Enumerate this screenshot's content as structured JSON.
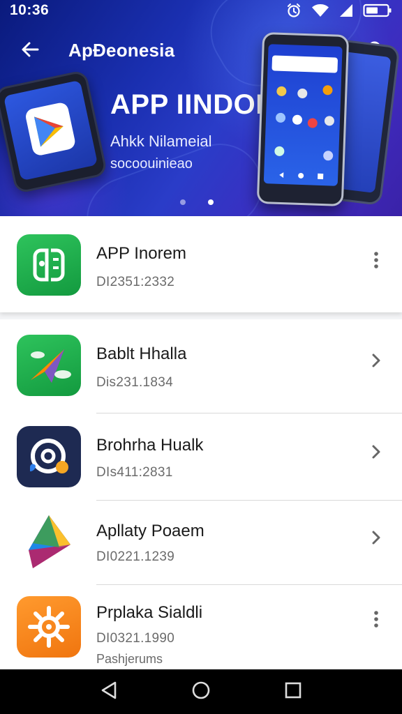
{
  "status_bar": {
    "time": "10:36"
  },
  "app_bar": {
    "title": "ApĐeonesia"
  },
  "hero": {
    "headline": "APP IINDONEQ",
    "subtitle": "Ahkk Nilameial",
    "caption": "socoouinieao",
    "page_count": 2,
    "active_page": 2
  },
  "featured_app": {
    "name": "APP Inorem",
    "code": "DI2351:2332"
  },
  "apps": [
    {
      "name": "Bablt Hhalla",
      "code": "Dis231.1834",
      "action": "chevron"
    },
    {
      "name": "Brohrha Hualk",
      "code": "DIs411:2831",
      "action": "chevron"
    },
    {
      "name": "Apllaty Poaem",
      "code": "DI0221.1239",
      "action": "chevron"
    },
    {
      "name": "Prplaka Sialdli",
      "code": "DI0321.1990",
      "tag": "Pashjerums",
      "action": "more"
    }
  ],
  "colors": {
    "hero_start": "#0a1a7c",
    "hero_end": "#3a22a8",
    "green_icon": "#1ea84a",
    "navy_icon": "#1e2a52",
    "orange_icon": "#f5871f"
  },
  "icons": {
    "back": "arrow-left-icon",
    "search": "search-icon",
    "more": "more-vertical-icon",
    "chevron": "chevron-right-icon"
  }
}
